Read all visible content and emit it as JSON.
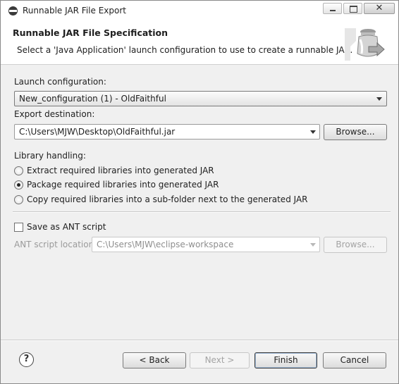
{
  "window": {
    "title": "Runnable JAR File Export",
    "close_glyph": "✕"
  },
  "banner": {
    "title": "Runnable JAR File Specification",
    "description": "Select a 'Java Application' launch configuration to use to create a runnable JAR."
  },
  "launch": {
    "label": "Launch configuration:",
    "selected": "New_configuration (1) - OldFaithful"
  },
  "export": {
    "label": "Export destination:",
    "value": "C:\\Users\\MJW\\Desktop\\OldFaithful.jar",
    "browse_label": "Browse..."
  },
  "library": {
    "label": "Library handling:",
    "options": [
      {
        "label": "Extract required libraries into generated JAR",
        "checked": false
      },
      {
        "label": "Package required libraries into generated JAR",
        "checked": true
      },
      {
        "label": "Copy required libraries into a sub-folder next to the generated JAR",
        "checked": false
      }
    ]
  },
  "ant": {
    "checkbox_label": "Save as ANT script",
    "checked": false,
    "location_label": "ANT script location:",
    "location_value": "C:\\Users\\MJW\\eclipse-workspace",
    "browse_label": "Browse..."
  },
  "footer": {
    "help_glyph": "?",
    "back_label": "< Back",
    "next_label": "Next >",
    "finish_label": "Finish",
    "cancel_label": "Cancel"
  }
}
